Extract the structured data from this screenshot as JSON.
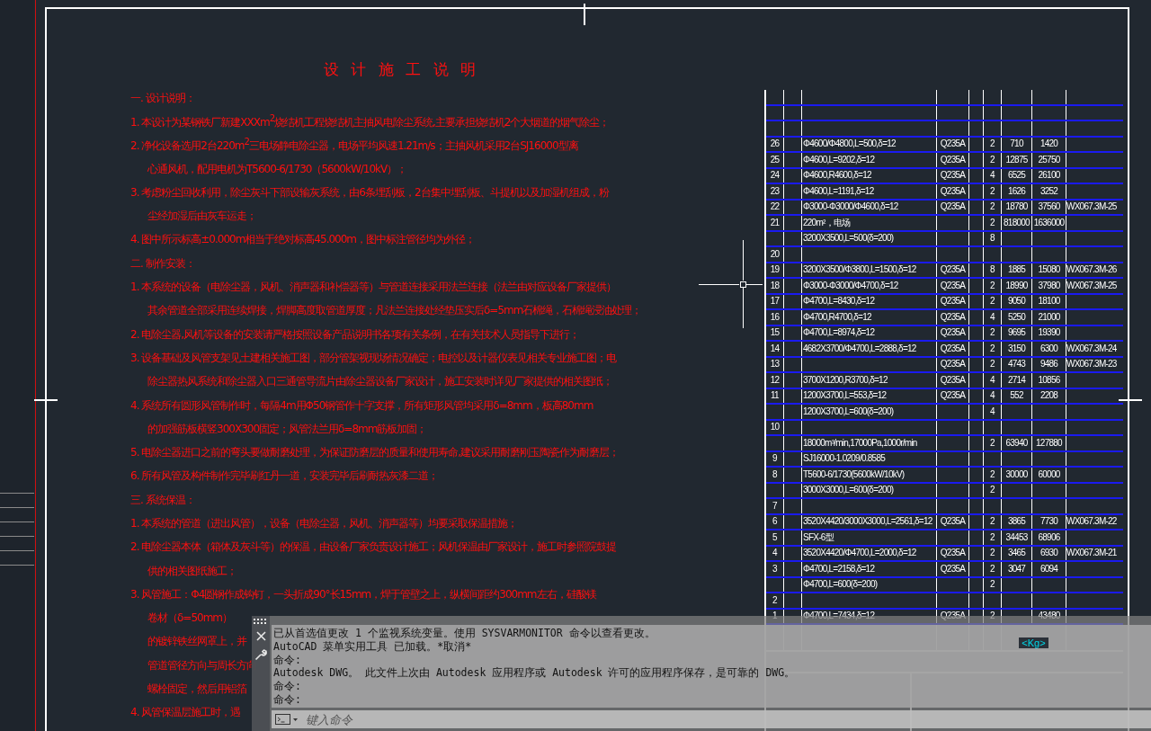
{
  "drawing": {
    "title": "设 计 施 工 说 明",
    "notes": [
      {
        "kind": "heading",
        "text": "一. 设计说明："
      },
      {
        "kind": "item",
        "text": "1. 本设计为某钢铁厂新建XXXm$^{2}$烧结机工程烧结机主抽风电除尘系统,主要承担烧结机2个大烟道的烟气除尘；"
      },
      {
        "kind": "item",
        "text": "2. 净化设备选用2台220m$^{2}$三电场静电除尘器，电场平均风速1.21m/s；主抽风机采用2台SJ16000型离"
      },
      {
        "kind": "continuation",
        "text": "心通风机，配用电机为T5600-6/1730（5600kW/10kV）；"
      },
      {
        "kind": "item",
        "text": "3. 考虑粉尘回收利用，除尘灰斗下部设输灰系统，由6条埋刮板，2台集中埋刮板、斗提机以及加湿机组成，粉"
      },
      {
        "kind": "continuation",
        "text": "尘经加湿后由灰车运走；"
      },
      {
        "kind": "item",
        "text": "4. 图中所示标高±0.000m相当于绝对标高45.000m，图中标注管径均为外径；"
      },
      {
        "kind": "heading",
        "text": "二. 制作安装："
      },
      {
        "kind": "item",
        "text": "1. 本系统的设备（电除尘器，风机、消声器和补偿器等）与管道连接采用法兰连接（法兰由对应设备厂家提供）"
      },
      {
        "kind": "continuation",
        "text": "其余管道全部采用连续焊接，焊脚高度取管道厚度；凡法兰连接处经垫压实后δ=5mm石棉绳，石棉绳浸油处理；"
      },
      {
        "kind": "item",
        "text": "2. 电除尘器,风机等设备的安装请严格按照设备产品说明书各项有关条例，在有关技术人员指导下进行；"
      },
      {
        "kind": "item",
        "text": "3. 设备基础及风管支架见土建相关施工图，部分管架视现场情况确定；电控以及计器仪表见相关专业施工图；电"
      },
      {
        "kind": "continuation",
        "text": "除尘器热风系统和除尘器入口三通管导流片由除尘器设备厂家设计，施工安装时详见厂家提供的相关图纸；"
      },
      {
        "kind": "item",
        "text": "4. 系统所有圆形风管制作时，每隔4m用Φ50钢管作十字支撑，所有矩形风管均采用δ=8mm，板高80mm"
      },
      {
        "kind": "continuation",
        "text": "的加强筋板横竖300X300固定；风管法兰用δ=8mm筋板加固；"
      },
      {
        "kind": "item",
        "text": "5. 电除尘器进口之前的弯头要做耐磨处理，为保证防磨层的质量和使用寿命,建议采用耐磨刚玉陶瓷作为耐磨层；"
      },
      {
        "kind": "item",
        "text": "6. 所有风管及构件制作完毕刷红丹一道，安装完毕后刷耐热灰漆二道；"
      },
      {
        "kind": "heading",
        "text": "三. 系统保温："
      },
      {
        "kind": "item",
        "text": "1. 本系统的管道（进出风管），设备（电除尘器，风机、消声器等）均要采取保温措施；"
      },
      {
        "kind": "item",
        "text": "2. 电除尘器本体（箱体及灰斗等）的保温，由设备厂家负责设计施工；风机保温由厂家设计，施工时参照院鼓提"
      },
      {
        "kind": "continuation",
        "text": "供的相关图纸施工；"
      },
      {
        "kind": "item",
        "text": "3. 风管施工：Φ4圆钢作成钩钉，一头折成90°长15mm，焊于管壁之上，纵横间距约300mm左右，硅酸镁"
      },
      {
        "kind": "continuation",
        "text": "卷材（δ=50mm）"
      },
      {
        "kind": "continuation",
        "text": "的镀锌铁丝网罩上，并"
      },
      {
        "kind": "continuation",
        "text": "管道管径方向与周长方向"
      },
      {
        "kind": "continuation",
        "text": "螺栓固定，然后用铝箔"
      },
      {
        "kind": "item",
        "text": "4. 风管保温层施工时，遇"
      }
    ]
  },
  "table": {
    "rows": [
      {},
      {},
      {},
      {
        "no": "26",
        "spec": "Φ4600/Φ4800,L=500,δ=12",
        "material": "Q235A",
        "qty": "2",
        "unit_weight": "710",
        "total_weight": "1420"
      },
      {
        "no": "25",
        "spec": "Φ4600,L=9202,δ=12",
        "material": "Q235A",
        "qty": "2",
        "unit_weight": "12875",
        "total_weight": "25750"
      },
      {
        "no": "24",
        "spec": "Φ4600,R4600,δ=12",
        "material": "Q235A",
        "qty": "4",
        "unit_weight": "6525",
        "total_weight": "26100"
      },
      {
        "no": "23",
        "spec": "Φ4600,L=1191,δ=12",
        "material": "Q235A",
        "qty": "2",
        "unit_weight": "1626",
        "total_weight": "3252"
      },
      {
        "no": "22",
        "spec": "Φ3000-Φ3000/Φ4600,δ=12",
        "material": "Q235A",
        "qty": "2",
        "unit_weight": "18780",
        "total_weight": "37560",
        "remark": "WX067.3M-25"
      },
      {
        "no": "21",
        "spec": "220m²，电场",
        "qty": "2",
        "unit_weight": "818000",
        "total_weight": "1636000"
      },
      {
        "spec": "3200X3500,L=500(δ=200)",
        "qty": "8"
      },
      {
        "no": "20"
      },
      {
        "no": "19",
        "spec": "3200X3500/Φ3800,L=1500,δ=12",
        "material": "Q235A",
        "qty": "8",
        "unit_weight": "1885",
        "total_weight": "15080",
        "remark": "WX067.3M-26"
      },
      {
        "no": "18",
        "spec": "Φ3000-Φ3000/Φ4700,δ=12",
        "material": "Q235A",
        "qty": "2",
        "unit_weight": "18990",
        "total_weight": "37980",
        "remark": "WX067.3M-25"
      },
      {
        "no": "17",
        "spec": "Φ4700,L=8430,δ=12",
        "material": "Q235A",
        "qty": "2",
        "unit_weight": "9050",
        "total_weight": "18100"
      },
      {
        "no": "16",
        "spec": "Φ4700,R4700,δ=12",
        "material": "Q235A",
        "qty": "4",
        "unit_weight": "5250",
        "total_weight": "21000"
      },
      {
        "no": "15",
        "spec": "Φ4700,L=8974,δ=12",
        "material": "Q235A",
        "qty": "2",
        "unit_weight": "9695",
        "total_weight": "19390"
      },
      {
        "no": "14",
        "spec": "4682X3700/Φ4700,L=2888,δ=12",
        "material": "Q235A",
        "qty": "2",
        "unit_weight": "3150",
        "total_weight": "6300",
        "remark": "WX067.3M-24"
      },
      {
        "no": "13",
        "material": "Q235A",
        "qty": "2",
        "unit_weight": "4743",
        "total_weight": "9486",
        "remark": "WX067.3M-23"
      },
      {
        "no": "12",
        "spec": "3700X1200,R3700,δ=12",
        "material": "Q235A",
        "qty": "4",
        "unit_weight": "2714",
        "total_weight": "10856"
      },
      {
        "no": "11",
        "spec": "1200X3700,L=553,δ=12",
        "material": "Q235A",
        "qty": "4",
        "unit_weight": "552",
        "total_weight": "2208"
      },
      {
        "spec": "1200X3700,L=600(δ=200)",
        "qty": "4"
      },
      {
        "no": "10"
      },
      {
        "spec": "18000m³/min,17000Pa,1000r/min",
        "qty": "2",
        "unit_weight": "63940",
        "total_weight": "127880"
      },
      {
        "no": "9",
        "spec": "SJ16000-1.0209/0.8585"
      },
      {
        "no": "8",
        "spec": "T5600-6/1730(5600kW/10kV)",
        "qty": "2",
        "unit_weight": "30000",
        "total_weight": "60000"
      },
      {
        "spec": "3000X3000,L=600(δ=200)",
        "qty": "2"
      },
      {
        "no": "7"
      },
      {
        "no": "6",
        "spec": "3520X4420/3000X3000,L=2561,δ=12",
        "material": "Q235A",
        "qty": "2",
        "unit_weight": "3865",
        "total_weight": "7730",
        "remark": "WX067.3M-22"
      },
      {
        "no": "5",
        "spec": "SFX-6型",
        "qty": "2",
        "unit_weight": "34453",
        "total_weight": "68906"
      },
      {
        "no": "4",
        "spec": "3520X4420/Φ4700,L=2000,δ=12",
        "material": "Q235A",
        "qty": "2",
        "unit_weight": "3465",
        "total_weight": "6930",
        "remark": "WX067.3M-21"
      },
      {
        "no": "3",
        "spec": "Φ4700,L=2158,δ=12",
        "material": "Q235A",
        "qty": "2",
        "unit_weight": "3047",
        "total_weight": "6094"
      },
      {
        "spec": "Φ4700,L=600(δ=200)",
        "qty": "2"
      },
      {
        "no": "2"
      },
      {
        "no": "1",
        "spec": "Φ4700,L=7434,δ=12",
        "material": "Q235A",
        "qty": "2",
        "total_weight": "43480"
      }
    ],
    "weight_unit": "<Kg>"
  },
  "command_line": {
    "history": [
      "已从首选值更改 1 个监视系统变量。使用 SYSVARMONITOR 命令以查看更改。",
      "AutoCAD 菜单实用工具 已加载。*取消*",
      "命令:",
      "Autodesk DWG。 此文件上次由 Autodesk 应用程序或 Autodesk 许可的应用程序保存，是可靠的 DWG。",
      "命令:",
      "命令:"
    ],
    "placeholder": "键入命令"
  }
}
